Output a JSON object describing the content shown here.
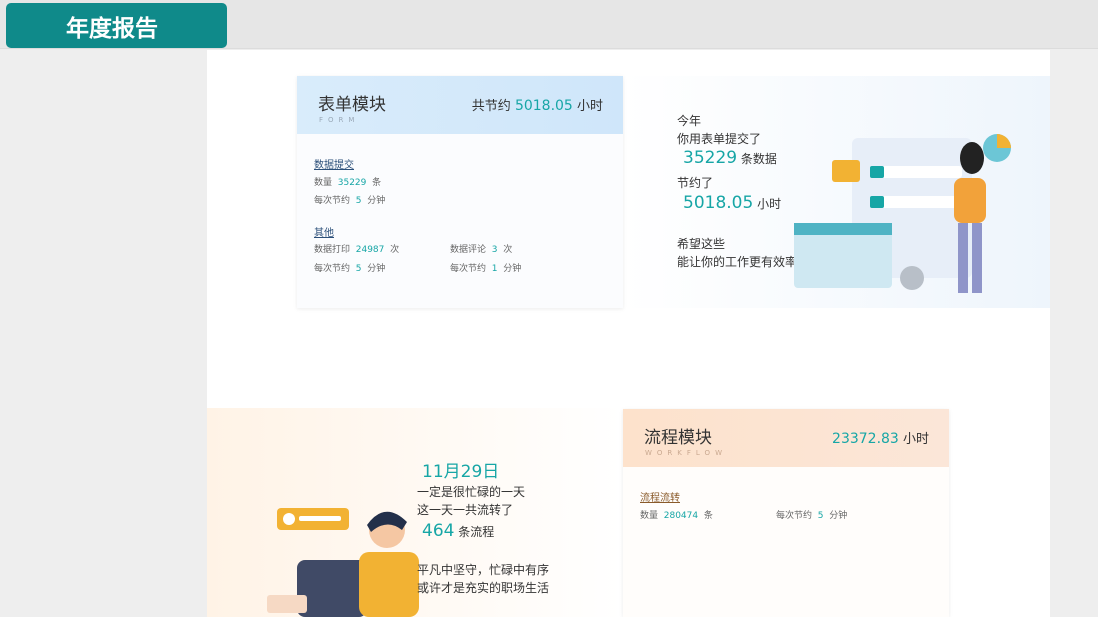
{
  "header": {
    "title": "年度报告"
  },
  "form_module": {
    "title": "表单模块",
    "subtitle": "FORM",
    "total_prefix": "共节约",
    "total_value": "5018.05",
    "total_unit": "小时",
    "submit_section": {
      "title": "数据提交",
      "count_label": "数量",
      "count_value": "35229",
      "count_unit": "条",
      "save_label": "每次节约",
      "save_value": "5",
      "save_unit": "分钟"
    },
    "other_section": {
      "title": "其他",
      "print_label": "数据打印",
      "print_value": "24987",
      "print_unit": "次",
      "print_save_label": "每次节约",
      "print_save_value": "5",
      "print_save_unit": "分钟",
      "comment_label": "数据评论",
      "comment_value": "3",
      "comment_unit": "次",
      "comment_save_label": "每次节约",
      "comment_save_value": "1",
      "comment_save_unit": "分钟"
    }
  },
  "form_summary": {
    "line1": "今年",
    "line2": "你用表单提交了",
    "count": "35229",
    "count_unit": "条数据",
    "line3": "节约了",
    "hours": "5018.05",
    "hours_unit": "小时",
    "line4": "希望这些",
    "line5": "能让你的工作更有效率"
  },
  "workflow_module": {
    "title": "流程模块",
    "subtitle": "WORKFLOW",
    "total_value": "23372.83",
    "total_unit": "小时",
    "section_title": "流程流转",
    "count_label": "数量",
    "count_value": "280474",
    "count_unit": "条",
    "save_label": "每次节约",
    "save_value": "5",
    "save_unit": "分钟"
  },
  "workflow_summary": {
    "date": "11月29日",
    "line1": "一定是很忙碌的一天",
    "line2": "这一天一共流转了",
    "count": "464",
    "count_unit": "条流程",
    "line3": "平凡中坚守，忙碌中有序",
    "line4": "或许才是充实的职场生活"
  },
  "colors": {
    "accent": "#17a6a6",
    "badge": "#0f8a8a"
  }
}
